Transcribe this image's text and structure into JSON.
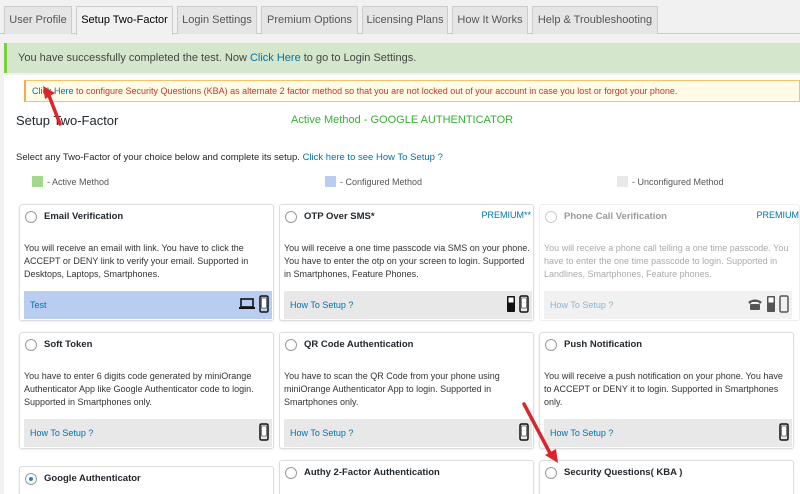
{
  "tabs": [
    {
      "label": "User Profile"
    },
    {
      "label": "Setup Two-Factor"
    },
    {
      "label": "Login Settings"
    },
    {
      "label": "Premium Options"
    },
    {
      "label": "Licensing Plans"
    },
    {
      "label": "How It Works"
    },
    {
      "label": "Help & Troubleshooting"
    }
  ],
  "notice": {
    "prefix": "You have successfully completed the test. Now ",
    "link": "Click Here",
    "suffix": " to go to Login Settings."
  },
  "kba_notice": {
    "link": "Click Here",
    "text": " to configure Security Questions (KBA) as alternate 2 factor method so that you are not locked out of your account in case you lost or forgot your phone."
  },
  "header": {
    "title": "Setup Two-Factor",
    "active_method": "Active Method - GOOGLE AUTHENTICATOR"
  },
  "select": {
    "text": "Select any Two-Factor of your choice below and complete its setup. ",
    "link": "Click here to see How To Setup ?"
  },
  "legend": [
    {
      "label": "- Active Method",
      "color": "#a3d98a"
    },
    {
      "label": "- Configured Method",
      "color": "#b8cdf0"
    },
    {
      "label": "- Unconfigured Method",
      "color": "#e8e8e8"
    }
  ],
  "cards": [
    {
      "title": "Email Verification",
      "premium": "",
      "desc": "You will receive an email with link. You have to click the ACCEPT or DENY link to verify your email. Supported in Desktops, Laptops, Smartphones.",
      "link": "Test"
    },
    {
      "title": "OTP Over SMS*",
      "premium": "PREMIUM**",
      "desc": "You will receive a one time passcode via SMS on your phone. You have to enter the otp on your screen to login. Supported in Smartphones, Feature Phones.",
      "link": "How To Setup ?"
    },
    {
      "title": "Phone Call Verification",
      "premium": "PREMIUM",
      "desc": "You will receive a phone call telling a one time passcode. You have to enter the one time passcode to login. Supported in Landlines, Smartphones, Feature phones.",
      "link": "How To Setup ?"
    },
    {
      "title": "Soft Token",
      "premium": "",
      "desc": "You have to enter 6 digits code generated by miniOrange Authenticator App like Google Authenticator code to login. Supported in Smartphones only.",
      "link": "How To Setup ?"
    },
    {
      "title": "QR Code Authentication",
      "premium": "",
      "desc": "You have to scan the QR Code from your phone using miniOrange Authenticator App to login. Supported in Smartphones only.",
      "link": "How To Setup ?"
    },
    {
      "title": "Push Notification",
      "premium": "",
      "desc": "You will receive a push notification on your phone. You have to ACCEPT or DENY it to login. Supported in Smartphones only.",
      "link": "How To Setup ?"
    },
    {
      "title": "Google Authenticator",
      "premium": "",
      "desc": "",
      "link": ""
    },
    {
      "title": "Authy 2-Factor Authentication",
      "premium": "",
      "desc": "",
      "link": ""
    },
    {
      "title": "Security Questions( KBA )",
      "premium": "",
      "desc": "",
      "link": ""
    }
  ],
  "colors": {
    "accent": "#0073aa",
    "active_green": "#33b233",
    "notice_bg": "#d4e7cc",
    "test_bg": "#b8cdf0",
    "arrow": "#d9262c"
  }
}
